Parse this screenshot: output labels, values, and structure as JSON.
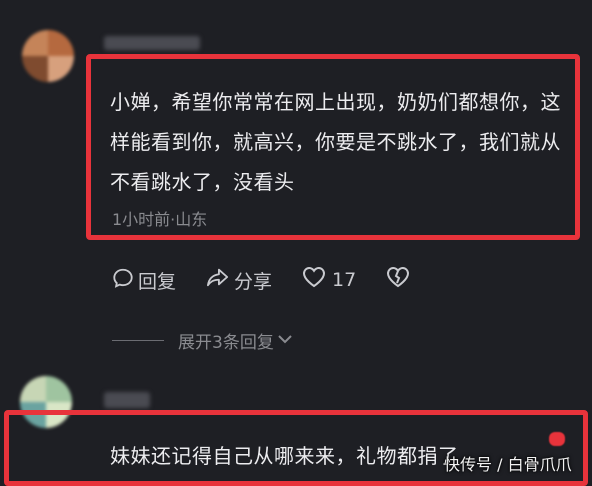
{
  "comments": [
    {
      "text": "小婵，希望你常常在网上出现，奶奶们都想你，这样能看到你，就高兴，你要是不跳水了，我们就从不看跳水了，没看头",
      "meta": "1小时前·山东",
      "actions": {
        "reply_label": "回复",
        "share_label": "分享",
        "like_count": "17"
      },
      "expand_label": "展开3条回复"
    },
    {
      "text": "妹妹还记得自己从哪来来，礼物都捐了"
    }
  ],
  "watermark": "快传号 / 白骨爪爪",
  "colors": {
    "highlight": "#e8333b",
    "background": "#1e1f24"
  },
  "icons": [
    "reply-icon",
    "share-icon",
    "heart-icon",
    "broken-heart-icon",
    "chevron-down-icon"
  ]
}
